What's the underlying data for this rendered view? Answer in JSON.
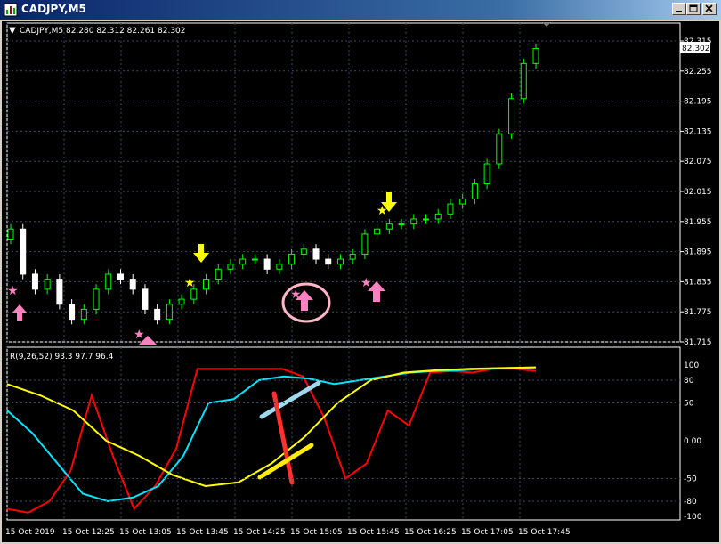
{
  "window": {
    "title": "CADJPY,M5"
  },
  "main": {
    "info": "CADJPY,M5  82.280 82.312 82.261 82.302",
    "price_ticks": [
      "82.315",
      "82.255",
      "82.195",
      "82.135",
      "82.075",
      "82.015",
      "81.955",
      "81.895",
      "81.835",
      "81.775",
      "81.715"
    ],
    "current_price": "82.302"
  },
  "indicator": {
    "info": "R(9,26,52) 93.3 97.7 96.4",
    "levels": [
      "100",
      "80",
      "50",
      "0.00",
      "-50",
      "-80",
      "-100"
    ]
  },
  "time_axis": [
    "15 Oct 2019",
    "15 Oct 12:25",
    "15 Oct 13:05",
    "15 Oct 13:45",
    "15 Oct 14:25",
    "15 Oct 15:05",
    "15 Oct 15:45",
    "15 Oct 16:25",
    "15 Oct 17:05",
    "15 Oct 17:45"
  ],
  "colors": {
    "bg": "#000000",
    "grid": "#3c4a5a",
    "candle_up": "#00ff00",
    "candle_down": "#ffffff",
    "rsi_fast": "#ff0000",
    "rsi_mid": "#00e5ff",
    "rsi_slow": "#ffff00",
    "arrow_up": "#ff80c0",
    "arrow_down": "#ffff00",
    "circle": "#ffb6c8"
  },
  "chart_data": {
    "type": "line",
    "title": "CADJPY,M5",
    "ylim": [
      81.715,
      82.315
    ],
    "series": [
      {
        "name": "CADJPY",
        "values": [
          81.94,
          81.85,
          81.82,
          81.84,
          81.79,
          81.76,
          81.78,
          81.82,
          81.85,
          81.84,
          81.82,
          81.78,
          81.76,
          81.79,
          81.8,
          81.82,
          81.84,
          81.86,
          81.87,
          81.88,
          81.88,
          81.86,
          81.87,
          81.89,
          81.9,
          81.88,
          81.87,
          81.88,
          81.89,
          81.93,
          81.94,
          81.95,
          81.95,
          81.96,
          81.96,
          81.97,
          81.99,
          82.0,
          82.03,
          82.07,
          82.13,
          82.2,
          82.27,
          82.3
        ]
      },
      {
        "name": "R 9",
        "values": [
          -90,
          -95,
          -80,
          -40,
          60,
          -20,
          -90,
          -60,
          -10,
          95,
          95,
          95,
          95,
          95,
          85,
          30,
          -50,
          -30,
          40,
          20,
          90,
          92,
          90,
          95,
          95,
          92
        ]
      },
      {
        "name": "R 26",
        "values": [
          40,
          10,
          -30,
          -70,
          -80,
          -75,
          -60,
          -20,
          50,
          55,
          80,
          85,
          82,
          75,
          80,
          85,
          90,
          92,
          93,
          95,
          96,
          97
        ]
      },
      {
        "name": "R 52",
        "values": [
          75,
          60,
          40,
          0,
          -20,
          -45,
          -60,
          -55,
          -30,
          5,
          50,
          80,
          90,
          93,
          95,
          96,
          97
        ]
      }
    ]
  }
}
